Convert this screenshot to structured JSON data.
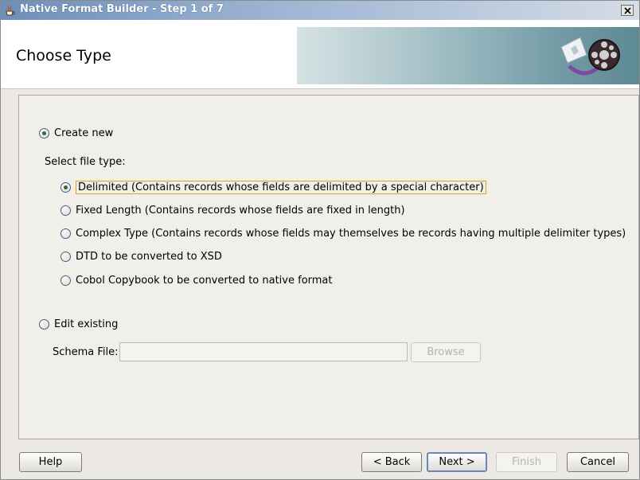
{
  "window": {
    "title": "Native Format Builder - Step 1 of 7",
    "close_icon": "close-icon",
    "title_icon": "java-cup-icon"
  },
  "header": {
    "title": "Choose Type",
    "emblem_icon": "format-builder-emblem-icon"
  },
  "create_new": {
    "label": "Create new",
    "selected": true
  },
  "file_type": {
    "heading": "Select file type:",
    "options": [
      {
        "label": "Delimited (Contains records whose fields are delimited by a special character)",
        "selected": true
      },
      {
        "label": "Fixed Length (Contains records whose fields are fixed in length)",
        "selected": false
      },
      {
        "label": "Complex Type (Contains records whose fields may themselves be records having multiple delimiter types)",
        "selected": false
      },
      {
        "label": "DTD to be converted to XSD",
        "selected": false
      },
      {
        "label": "Cobol Copybook to be converted to native format",
        "selected": false
      }
    ]
  },
  "edit_existing": {
    "label": "Edit existing",
    "selected": false,
    "schema_file_label": "Schema File:",
    "schema_file_value": "",
    "browse_label": "Browse"
  },
  "buttons": {
    "help": "Help",
    "back": "< Back",
    "next": "Next >",
    "finish": "Finish",
    "cancel": "Cancel"
  }
}
